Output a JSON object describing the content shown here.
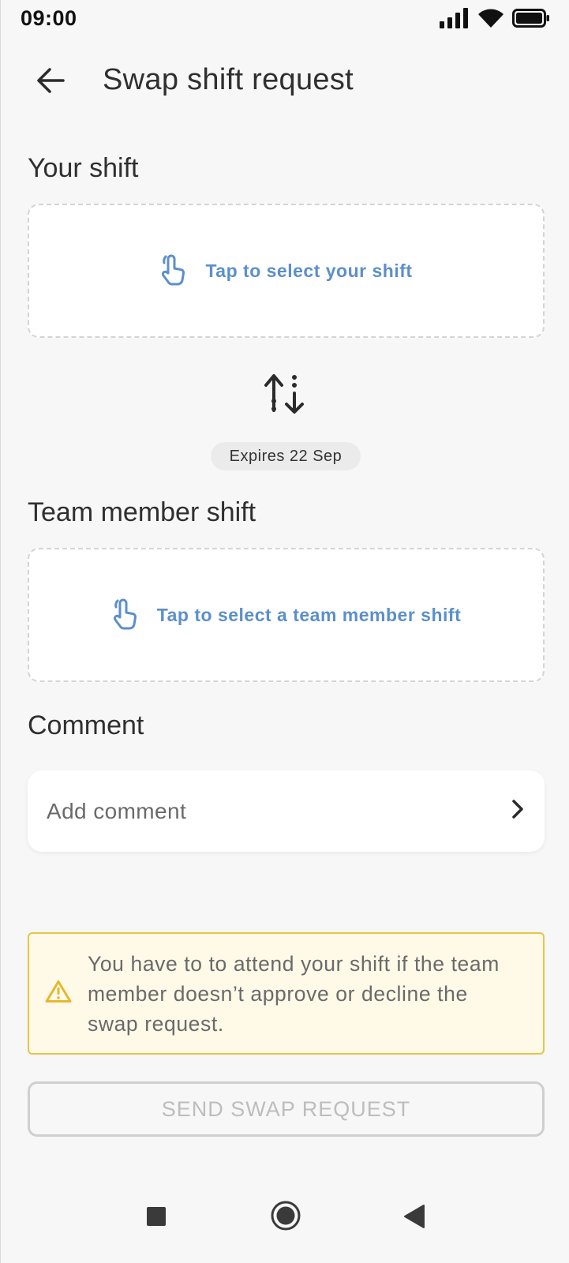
{
  "status_bar": {
    "time": "09:00",
    "icons": [
      "signal-icon",
      "wifi-icon",
      "battery-icon"
    ]
  },
  "header": {
    "title": "Swap shift request",
    "back_icon": "arrow-left-icon"
  },
  "your_shift": {
    "title": "Your shift",
    "select_label": "Tap to select your shift",
    "icon": "tap-hand-icon"
  },
  "swap": {
    "icon": "swap-vertical-icon",
    "expires": "Expires 22 Sep"
  },
  "team_member_shift": {
    "title": "Team member shift",
    "select_label": "Tap to select a team member shift",
    "icon": "tap-hand-icon"
  },
  "comment": {
    "title": "Comment",
    "placeholder": "Add comment",
    "icon": "chevron-right-icon"
  },
  "warning": {
    "icon": "warning-triangle-icon",
    "text": "You have to to attend your shift if the team member doesn’t approve or decline the swap request."
  },
  "send_button": {
    "label": "SEND SWAP REQUEST",
    "enabled": false
  },
  "nav_bar": {
    "icons": [
      "square-icon",
      "home-circle-icon",
      "back-triangle-icon"
    ]
  },
  "colors": {
    "accent": "#5b8fcc",
    "warning_border": "#e6c545",
    "warning_bg": "#fff9e8",
    "background": "#f7f7f7"
  }
}
